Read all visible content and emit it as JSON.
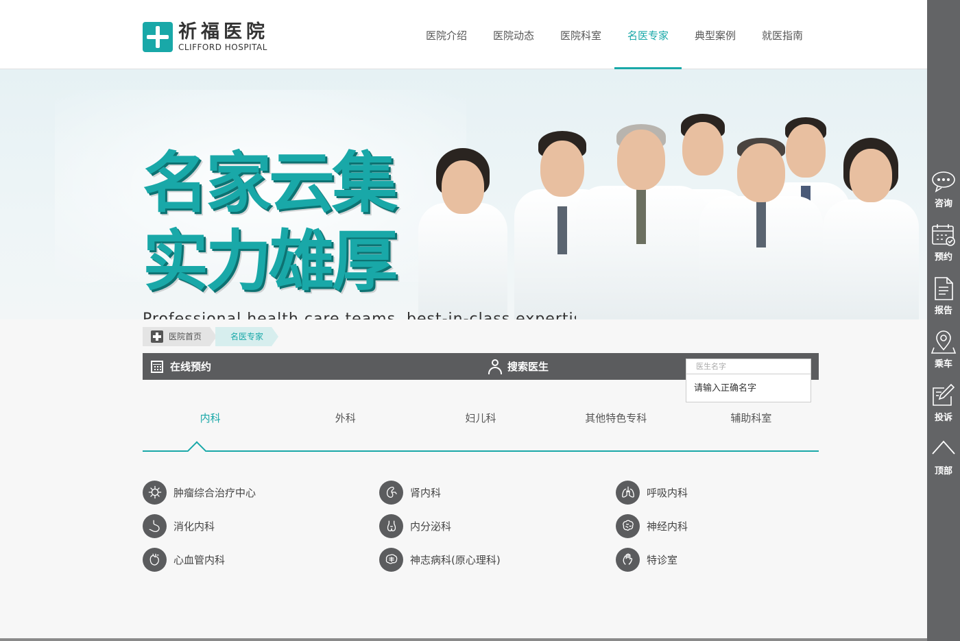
{
  "header": {
    "logo_cn": "祈福医院",
    "logo_en": "CLIFFORD HOSPITAL",
    "nav": [
      {
        "label": "医院介绍"
      },
      {
        "label": "医院动态"
      },
      {
        "label": "医院科室"
      },
      {
        "label": "名医专家",
        "active": true
      },
      {
        "label": "典型案例"
      },
      {
        "label": "就医指南"
      }
    ]
  },
  "banner": {
    "line1": "名家云集",
    "line2": "实力雄厚",
    "subtitle": "Professional health care teams, best-in-class expertise"
  },
  "breadcrumb": {
    "home": "医院首页",
    "current": "名医专家"
  },
  "searchbar": {
    "appoint_label": "在线预约",
    "search_label": "搜索医生",
    "input_placeholder": "医生名字",
    "input_value": "",
    "tip": "请输入正确名字"
  },
  "tabs": [
    {
      "label": "内科",
      "active": true
    },
    {
      "label": "外科"
    },
    {
      "label": "妇儿科"
    },
    {
      "label": "其他特色专科"
    },
    {
      "label": "辅助科室"
    }
  ],
  "departments": [
    {
      "label": "肿瘤综合治疗中心",
      "icon": "virus-icon"
    },
    {
      "label": "肾内科",
      "icon": "kidney-icon"
    },
    {
      "label": "呼吸内科",
      "icon": "lungs-icon"
    },
    {
      "label": "消化内科",
      "icon": "stomach-icon"
    },
    {
      "label": "内分泌科",
      "icon": "thyroid-icon"
    },
    {
      "label": "神经内科",
      "icon": "brain-icon"
    },
    {
      "label": "心血管内科",
      "icon": "heart-icon"
    },
    {
      "label": "神志病科(原心理科)",
      "icon": "brain-icon"
    },
    {
      "label": "特诊室",
      "icon": "hand-icon"
    }
  ],
  "sidebar": [
    {
      "label": "咨询",
      "icon": "chat-icon"
    },
    {
      "label": "预约",
      "icon": "calendar-icon"
    },
    {
      "label": "报告",
      "icon": "document-icon"
    },
    {
      "label": "乘车",
      "icon": "location-icon"
    },
    {
      "label": "投诉",
      "icon": "edit-icon"
    },
    {
      "label": "顶部",
      "icon": "arrow-up-icon"
    }
  ],
  "colors": {
    "accent": "#19a8a8",
    "bar": "#5b5c5e",
    "sidebar": "#636466"
  }
}
